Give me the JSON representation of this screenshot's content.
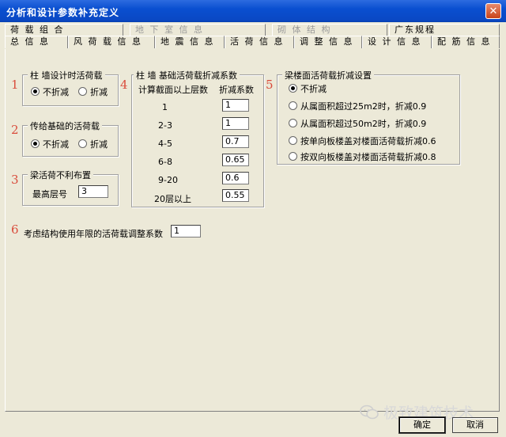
{
  "window": {
    "title": "分析和设计参数补充定义",
    "close_glyph": "✕"
  },
  "tabs_row1": [
    {
      "label": "荷 载 组 合",
      "disabled": false
    },
    {
      "label": "地 下 室 信 息",
      "disabled": true
    },
    {
      "label": "砌 体 结 构",
      "disabled": true
    },
    {
      "label": "广东规程",
      "disabled": false
    }
  ],
  "tabs_row2": [
    {
      "label": "总 信 息"
    },
    {
      "label": "风 荷 载 信 息"
    },
    {
      "label": "地 震 信 息"
    },
    {
      "label": "活 荷 信 息"
    },
    {
      "label": "调 整 信 息"
    },
    {
      "label": "设 计 信 息"
    },
    {
      "label": "配 筋 信 息"
    }
  ],
  "active_tab": "活 荷 信 息",
  "numbers": [
    "1",
    "2",
    "3",
    "4",
    "5",
    "6"
  ],
  "group1": {
    "title": "柱 墙设计时活荷载",
    "opt1": "不折减",
    "opt2": "折减",
    "selected": "不折减"
  },
  "group2": {
    "title": "传给基础的活荷载",
    "opt1": "不折减",
    "opt2": "折减",
    "selected": "不折减"
  },
  "group3": {
    "title": "梁活荷不利布置",
    "label": "最高层号",
    "value": "3"
  },
  "group4": {
    "title": "柱 墙 基础活荷载折减系数",
    "col1": "计算截面以上层数",
    "col2": "折减系数",
    "rows": [
      {
        "floors": "1",
        "factor": "1"
      },
      {
        "floors": "2-3",
        "factor": "1"
      },
      {
        "floors": "4-5",
        "factor": "0.7"
      },
      {
        "floors": "6-8",
        "factor": "0.65"
      },
      {
        "floors": "9-20",
        "factor": "0.6"
      },
      {
        "floors": "20层以上",
        "factor": "0.55"
      }
    ]
  },
  "group5": {
    "title": "梁楼面活荷载折减设置",
    "options": [
      "不折减",
      "从属面积超过25m2时，折减0.9",
      "从属面积超过50m2时，折减0.9",
      "按单向板楼盖对楼面活荷载折减0.6",
      "按双向板楼盖对楼面活荷载折减0.8"
    ],
    "selected_index": 0
  },
  "group6": {
    "label": "考虑结构使用年限的活荷载调整系数",
    "value": "1"
  },
  "buttons": {
    "ok": "确定",
    "cancel": "取消"
  },
  "watermark": "极致建筑技术",
  "colors": {
    "title_bar": "#0a4fd0",
    "panel": "#ece9d8",
    "number_red": "#d94c3c"
  }
}
